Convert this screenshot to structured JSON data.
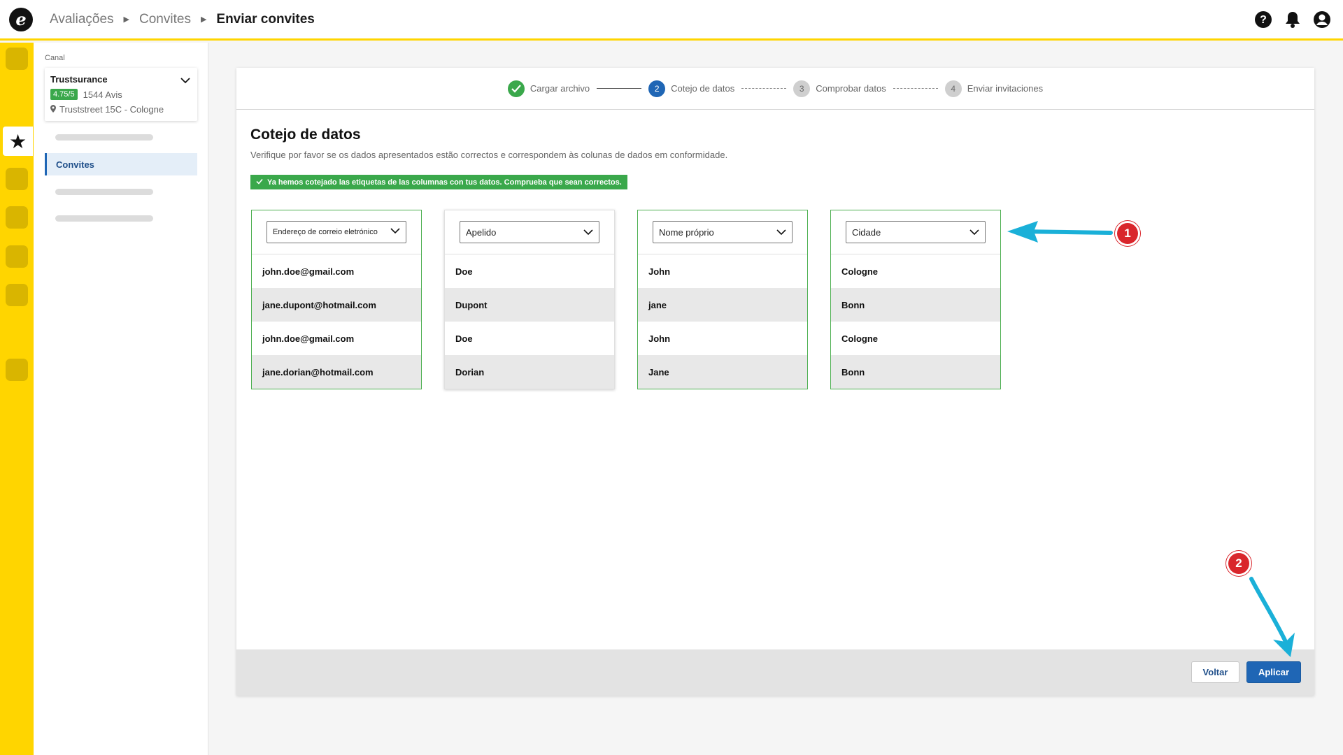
{
  "breadcrumb": {
    "items": [
      "Avaliações",
      "Convites"
    ],
    "current": "Enviar convites"
  },
  "header_icons": [
    "help-icon",
    "bell-icon",
    "user-icon"
  ],
  "sidebar": {
    "canal_label": "Canal",
    "channel": {
      "name": "Trustsurance",
      "rating": "4.75/5",
      "reviews": "1544 Avis",
      "address": "Truststreet 15C - Cologne"
    },
    "active_item": "Convites"
  },
  "stepper": {
    "steps": [
      {
        "number": "1",
        "label": "Cargar archivo",
        "state": "done"
      },
      {
        "number": "2",
        "label": "Cotejo de datos",
        "state": "current"
      },
      {
        "number": "3",
        "label": "Comprobar datos",
        "state": "todo"
      },
      {
        "number": "4",
        "label": "Enviar invitaciones",
        "state": "todo"
      }
    ]
  },
  "main": {
    "title": "Cotejo de datos",
    "description": "Verifique por favor se os dados apresentados estão correctos e correspondem às colunas de dados em conformidade.",
    "banner": "Ya hemos cotejado las etiquetas de las columnas con tus datos. Comprueba que sean correctos."
  },
  "columns": [
    {
      "select": "Endereço de correio eletrónico",
      "matched": true,
      "rows": [
        "john.doe@gmail.com",
        "jane.dupont@hotmail.com",
        "john.doe@gmail.com",
        "jane.dorian@hotmail.com"
      ]
    },
    {
      "select": "Apelido",
      "matched": false,
      "rows": [
        "Doe",
        "Dupont",
        "Doe",
        "Dorian"
      ]
    },
    {
      "select": "Nome próprio",
      "matched": true,
      "rows": [
        "John",
        "jane",
        "John",
        "Jane"
      ]
    },
    {
      "select": "Cidade",
      "matched": true,
      "rows": [
        "Cologne",
        "Bonn",
        "Cologne",
        "Bonn"
      ]
    }
  ],
  "footer": {
    "back_label": "Voltar",
    "apply_label": "Aplicar"
  },
  "annotations": {
    "marker_1": "1",
    "marker_2": "2",
    "color": "#d9262c",
    "arrow_color": "#1ab0d8"
  },
  "colors": {
    "brand_yellow": "#ffd500",
    "primary_blue": "#1f66b5",
    "success_green": "#3aa84b"
  }
}
